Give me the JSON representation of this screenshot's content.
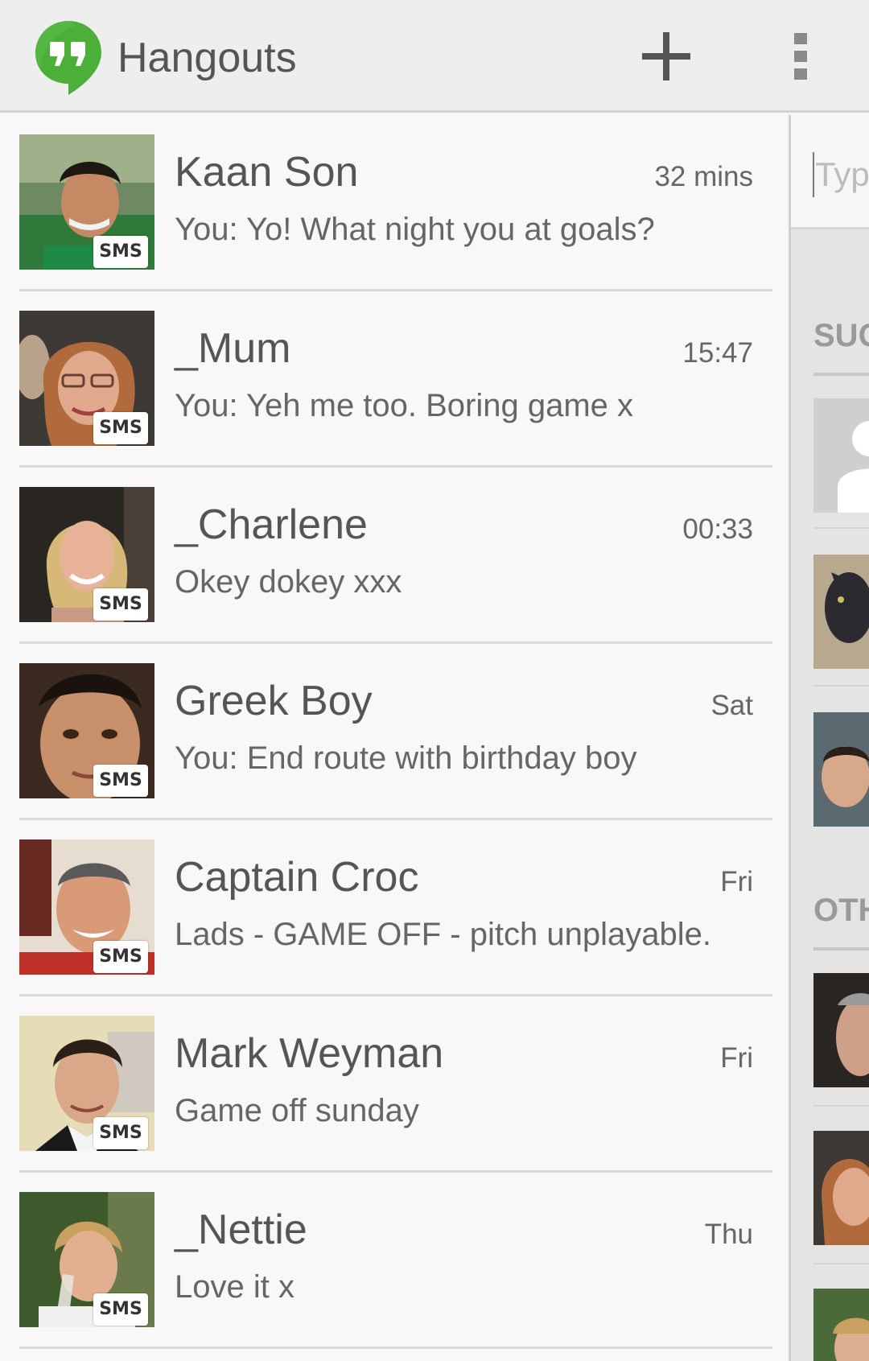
{
  "app": {
    "title": "Hangouts"
  },
  "toolbar": {
    "add_icon": "plus-icon",
    "overflow_icon": "overflow-menu-icon"
  },
  "conversations": [
    {
      "name": "Kaan Son",
      "time": "32 mins",
      "snippet": "You: Yo! What night you at goals?",
      "badge": "SMS"
    },
    {
      "name": "_Mum",
      "time": "15:47",
      "snippet": "You: Yeh me too. Boring game x",
      "badge": "SMS"
    },
    {
      "name": "_Charlene",
      "time": "00:33",
      "snippet": "Okey dokey xxx",
      "badge": "SMS"
    },
    {
      "name": "Greek Boy",
      "time": "Sat",
      "snippet": "You: End route with birthday boy",
      "badge": "SMS"
    },
    {
      "name": "Captain Croc",
      "time": "Fri",
      "snippet": "Lads - GAME OFF - pitch unplayable.",
      "badge": "SMS"
    },
    {
      "name": "Mark Weyman",
      "time": "Fri",
      "snippet": "Game off sunday",
      "badge": "SMS"
    },
    {
      "name": "_Nettie",
      "time": "Thu",
      "snippet": "Love it x",
      "badge": "SMS"
    }
  ],
  "side_panel": {
    "search_placeholder": "Type",
    "section_suggested": "SUG",
    "section_other": "OTH"
  },
  "colors": {
    "action_bar": "#eeeeee",
    "logo_green": "#4caf3a",
    "text_primary": "#555555",
    "divider": "#d9d9d9"
  }
}
